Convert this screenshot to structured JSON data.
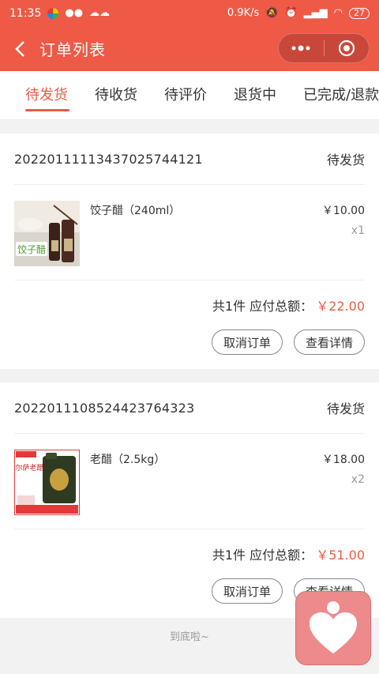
{
  "status_bar": {
    "time": "11:35",
    "net_speed": "0.9K/s",
    "battery": "27"
  },
  "navbar": {
    "title": "订单列表"
  },
  "tabs": [
    {
      "label": "待发货",
      "active": true
    },
    {
      "label": "待收货",
      "active": false
    },
    {
      "label": "待评价",
      "active": false
    },
    {
      "label": "退货中",
      "active": false
    },
    {
      "label": "已完成/退款",
      "active": false
    }
  ],
  "orders": [
    {
      "order_no": "20220111113437025744121",
      "status": "待发货",
      "product_name": "饺子醋（240ml）",
      "price": "￥10.00",
      "qty": "x1",
      "count_text": "共1件 应付总额：",
      "total": "￥22.00",
      "cancel_label": "取消订单",
      "detail_label": "查看详情",
      "thumb_text": "饺子醋"
    },
    {
      "order_no": "2022011108524423764323",
      "status": "待发货",
      "product_name": "老醋（2.5kg）",
      "price": "￥18.00",
      "qty": "x2",
      "count_text": "共1件 应付总额：",
      "total": "￥51.00",
      "cancel_label": "取消订单",
      "detail_label": "查看详情",
      "thumb_text": "强尔萨老醋"
    }
  ],
  "footer": {
    "end_text": "到底啦~"
  },
  "colors": {
    "brand": "#ee5a46",
    "float_button": "#ec8a8c"
  }
}
